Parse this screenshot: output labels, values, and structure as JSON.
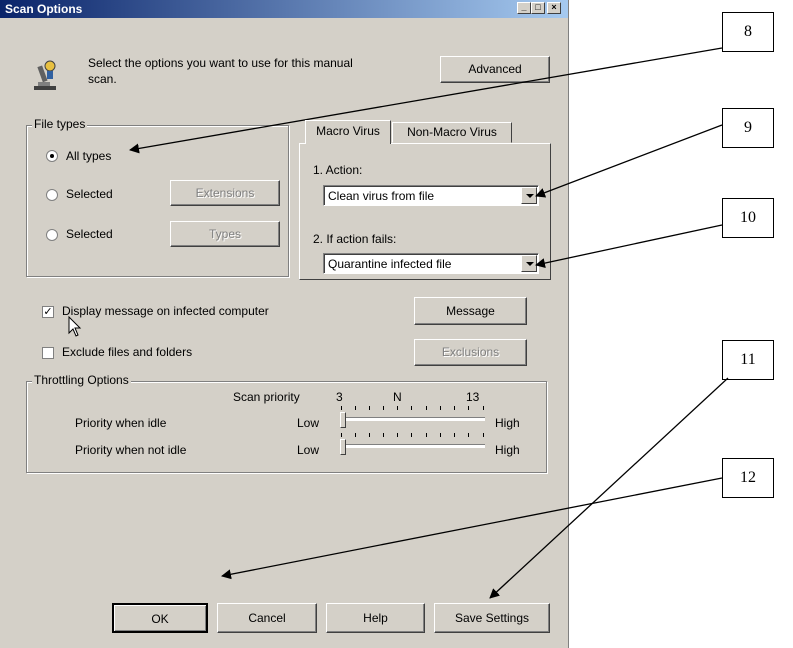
{
  "window": {
    "title": "Scan Options",
    "controls": {
      "minimize": "_",
      "maximize": "□",
      "close": "×"
    }
  },
  "intro": {
    "line1": "Select the options you want to use for this manual",
    "line2": "scan.",
    "advanced_button": "Advanced",
    "icon": "microscope-icon"
  },
  "file_types": {
    "legend": "File types",
    "options": [
      {
        "label": "All types",
        "selected": true
      },
      {
        "label": "Selected",
        "selected": false,
        "button": "Extensions"
      },
      {
        "label": "Selected",
        "selected": false,
        "button": "Types"
      }
    ]
  },
  "tabs": {
    "items": [
      "Macro Virus",
      "Non-Macro Virus"
    ],
    "active": "Macro Virus",
    "action_label": "1. Action:",
    "action_value": "Clean virus from file",
    "fallback_label": "2. If action fails:",
    "fallback_value": "Quarantine infected file"
  },
  "options": {
    "display_message": {
      "label": "Display message on infected computer",
      "checked": true
    },
    "message_button": "Message",
    "exclude": {
      "label": "Exclude files and folders",
      "checked": false
    },
    "exclusions_button": "Exclusions"
  },
  "throttling": {
    "legend": "Throttling Options",
    "scan_priority_label": "Scan priority",
    "scale_low_num": "3",
    "scale_mid": "N",
    "scale_high_num": "13",
    "rows": [
      {
        "label": "Priority when idle",
        "low": "Low",
        "high": "High",
        "level": 0
      },
      {
        "label": "Priority when not idle",
        "low": "Low",
        "high": "High",
        "level": 0
      }
    ]
  },
  "footer": {
    "ok": "OK",
    "cancel": "Cancel",
    "help": "Help",
    "save": "Save Settings"
  },
  "callouts": [
    "8",
    "9",
    "10",
    "11",
    "12"
  ]
}
